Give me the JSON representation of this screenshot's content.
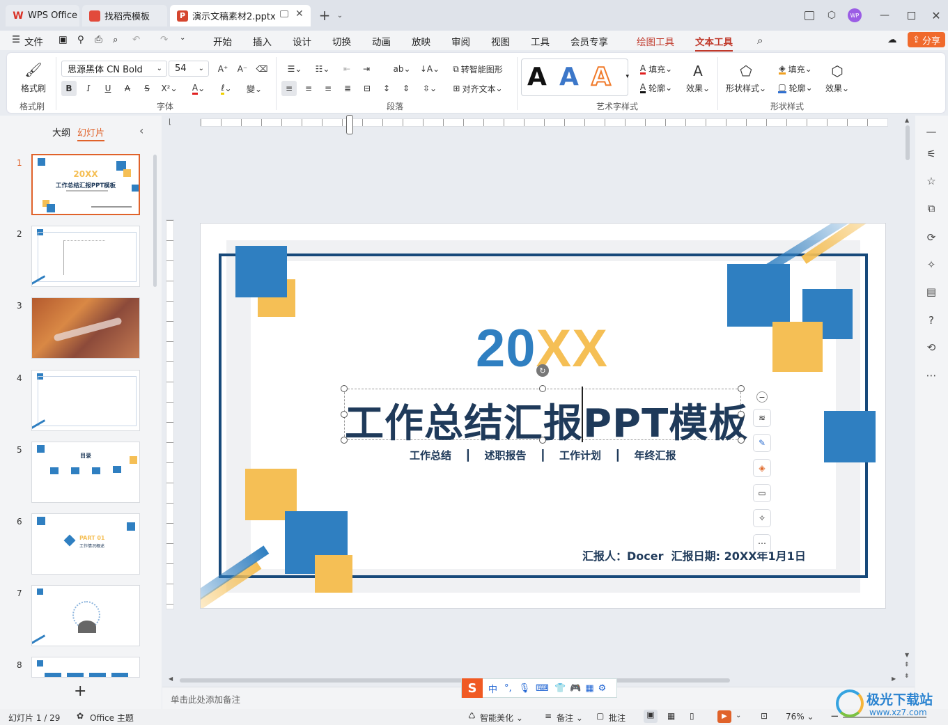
{
  "window": {
    "tabs": [
      {
        "label": "WPS Office"
      },
      {
        "label": "找稻壳模板"
      },
      {
        "label": "演示文稿素材2.pptx"
      }
    ],
    "avatar_text": "WP"
  },
  "menu": {
    "file": "文件",
    "items": [
      "开始",
      "插入",
      "设计",
      "切换",
      "动画",
      "放映",
      "审阅",
      "视图",
      "工具",
      "会员专享",
      "绘图工具",
      "文本工具"
    ],
    "active": "文本工具",
    "share": "分享"
  },
  "ribbon": {
    "format_painter": "格式刷",
    "format_painter_group": "格式刷",
    "font_name": "思源黑体 CN Bold",
    "font_size": "54",
    "font_group": "字体",
    "paragraph_group": "段落",
    "smart_shape": "转智能图形",
    "align_text": "对齐文本",
    "art_group": "艺术字样式",
    "fill": "填充",
    "outline": "轮廓",
    "effect": "效果",
    "shape_style": "形状样式",
    "shape_fill": "填充",
    "shape_outline": "轮廓",
    "shape_effect": "效果",
    "shape_group": "形状样式"
  },
  "left_pane": {
    "outline_tab": "大纲",
    "slides_tab": "幻灯片",
    "slide_numbers": [
      "1",
      "2",
      "3",
      "4",
      "5",
      "6",
      "7",
      "8"
    ],
    "thumb1_year": "20XX",
    "thumb1_title": "工作总结汇报PPT模板",
    "thumb5_title": "目录",
    "thumb6_part": "PART 01",
    "thumb6_sub": "工作情况概述"
  },
  "slide": {
    "year_prefix": "20",
    "year_suffix": "XX",
    "title": "工作总结汇报PPT模板",
    "subtitle_items": [
      "工作总结",
      "述职报告",
      "工作计划",
      "年终汇报"
    ],
    "reporter": "汇报人：Docer  汇报日期: 20XX年1月1日",
    "colors": {
      "blue": "#2f7fc1",
      "yellow": "#f5bf55",
      "dark": "#1f3a5a",
      "frame": "#17497a"
    }
  },
  "notes_placeholder": "单击此处添加备注",
  "ime": {
    "lang": "中"
  },
  "status": {
    "slide_info": "幻灯片 1 / 29",
    "theme": "Office 主题",
    "beautify": "智能美化",
    "notes": "备注",
    "comments": "批注",
    "zoom": "76%"
  },
  "watermark": {
    "title": "极光下载站",
    "url": "www.xz7.com"
  }
}
